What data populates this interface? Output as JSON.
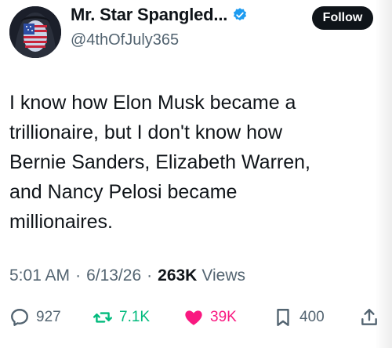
{
  "author": {
    "display_name": "Mr. Star Spangled...",
    "handle": "@4thOfJuly365",
    "verified": true,
    "verified_color": "#1d9bf0"
  },
  "follow_button": {
    "label": "Follow"
  },
  "tweet": {
    "text": "I know how Elon Musk became a\ntrillionaire, but I don't know how\nBernie Sanders, Elizabeth Warren,\nand Nancy Pelosi became\nmillionaires."
  },
  "meta": {
    "time": "5:01 AM",
    "separator": "·",
    "date": "6/13/26",
    "views_count": "263K",
    "views_label": "Views"
  },
  "actions": {
    "replies": {
      "icon": "reply-icon",
      "count": "927"
    },
    "reposts": {
      "icon": "repost-icon",
      "count": "7.1K",
      "color": "#00ba7c"
    },
    "likes": {
      "icon": "heart-icon",
      "count": "39K",
      "color": "#f91880"
    },
    "bookmarks": {
      "icon": "bookmark-icon",
      "count": "400"
    },
    "share": {
      "icon": "share-icon"
    }
  }
}
